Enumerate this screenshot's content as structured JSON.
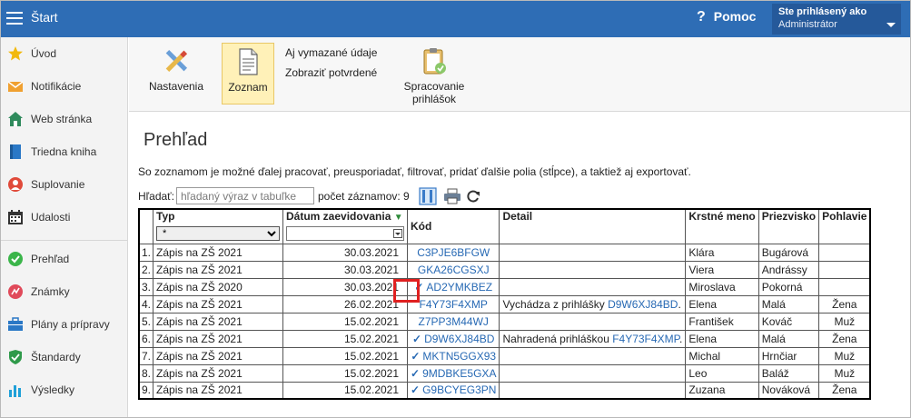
{
  "topbar": {
    "title": "Štart",
    "help_label": "Pomoc",
    "user_line1": "Ste prihlásený ako",
    "user_name": "Administrátor",
    "color": "#2e6db5"
  },
  "sidebar": {
    "items": [
      {
        "label": "Úvod",
        "icon": "star-icon"
      },
      {
        "label": "Notifikácie",
        "icon": "envelope-icon"
      },
      {
        "label": "Web stránka",
        "icon": "house-icon"
      },
      {
        "label": "Triedna kniha",
        "icon": "book-icon"
      },
      {
        "label": "Suplovanie",
        "icon": "person-icon"
      },
      {
        "label": "Udalosti",
        "icon": "calendar-icon"
      },
      {
        "label": "Prehľad",
        "icon": "check-circle-icon"
      },
      {
        "label": "Známky",
        "icon": "grade-icon"
      },
      {
        "label": "Plány a prípravy",
        "icon": "briefcase-icon"
      },
      {
        "label": "Štandardy",
        "icon": "shield-icon"
      },
      {
        "label": "Výsledky",
        "icon": "bar-chart-icon"
      }
    ]
  },
  "ribbon": {
    "settings_label": "Nastavenia",
    "list_label": "Zoznam",
    "show_deleted_label": "Aj vymazané údaje",
    "show_confirmed_label": "Zobraziť potvrdené",
    "processing_line1": "Spracovanie",
    "processing_line2": "prihlášok"
  },
  "main": {
    "title": "Prehľad",
    "description": "So zoznamom je možné ďalej pracovať, preusporiadať, filtrovať, pridať ďalšie polia (stĺpce), a taktiež aj exportovať.",
    "search_label": "Hľadať:",
    "search_placeholder": "hľadaný výraz v tabuľke",
    "record_count_label": "počet záznamov: 9"
  },
  "table": {
    "headers": {
      "type": "Typ",
      "date": "Dátum zaevidovania",
      "code": "Kód",
      "detail": "Detail",
      "first_name": "Krstné meno",
      "last_name": "Priezvisko",
      "gender": "Pohlavie"
    },
    "type_filter_value": "*",
    "rows": [
      {
        "n": "1.",
        "type": "Zápis na ZŠ 2021",
        "date": "30.03.2021",
        "checked": false,
        "code": "C3PJE6BFGW",
        "detail_text": "",
        "detail_link": "",
        "detail_suffix": "",
        "first": "Klára",
        "last": "Bugárová",
        "gender": ""
      },
      {
        "n": "2.",
        "type": "Zápis na ZŠ 2021",
        "date": "30.03.2021",
        "checked": false,
        "code": "GKA26CGSXJ",
        "detail_text": "",
        "detail_link": "",
        "detail_suffix": "",
        "first": "Viera",
        "last": "Andrássy",
        "gender": ""
      },
      {
        "n": "3.",
        "type": "Zápis na ZŠ 2020",
        "date": "30.03.2021",
        "checked": true,
        "code": "AD2YMKBEZ",
        "detail_text": "",
        "detail_link": "",
        "detail_suffix": "",
        "first": "Miroslava",
        "last": "Pokorná",
        "gender": ""
      },
      {
        "n": "4.",
        "type": "Zápis na ZŠ 2021",
        "date": "26.02.2021",
        "checked": false,
        "code": "F4Y73F4XMP",
        "detail_text": "Vychádza z prihlášky ",
        "detail_link": "D9W6XJ84BD",
        "detail_suffix": ".",
        "first": "Elena",
        "last": "Malá",
        "gender": "Žena"
      },
      {
        "n": "5.",
        "type": "Zápis na ZŠ 2021",
        "date": "15.02.2021",
        "checked": false,
        "code": "Z7PP3M44WJ",
        "detail_text": "",
        "detail_link": "",
        "detail_suffix": "",
        "first": "František",
        "last": "Kováč",
        "gender": "Muž"
      },
      {
        "n": "6.",
        "type": "Zápis na ZŠ 2021",
        "date": "15.02.2021",
        "checked": true,
        "code": "D9W6XJ84BD",
        "detail_text": "Nahradená prihláškou ",
        "detail_link": "F4Y73F4XMP",
        "detail_suffix": ".",
        "first": "Elena",
        "last": "Malá",
        "gender": "Žena"
      },
      {
        "n": "7.",
        "type": "Zápis na ZŠ 2021",
        "date": "15.02.2021",
        "checked": true,
        "code": "MKTN5GGX93",
        "detail_text": "",
        "detail_link": "",
        "detail_suffix": "",
        "first": "Michal",
        "last": "Hrnčiar",
        "gender": "Muž"
      },
      {
        "n": "8.",
        "type": "Zápis na ZŠ 2021",
        "date": "15.02.2021",
        "checked": true,
        "code": "9MDBKE5GXA",
        "detail_text": "",
        "detail_link": "",
        "detail_suffix": "",
        "first": "Leo",
        "last": "Baláž",
        "gender": "Muž"
      },
      {
        "n": "9.",
        "type": "Zápis na ZŠ 2021",
        "date": "15.02.2021",
        "checked": true,
        "code": "G9BCYEG3PN",
        "detail_text": "",
        "detail_link": "",
        "detail_suffix": "",
        "first": "Zuzana",
        "last": "Nováková",
        "gender": "Žena"
      }
    ]
  }
}
